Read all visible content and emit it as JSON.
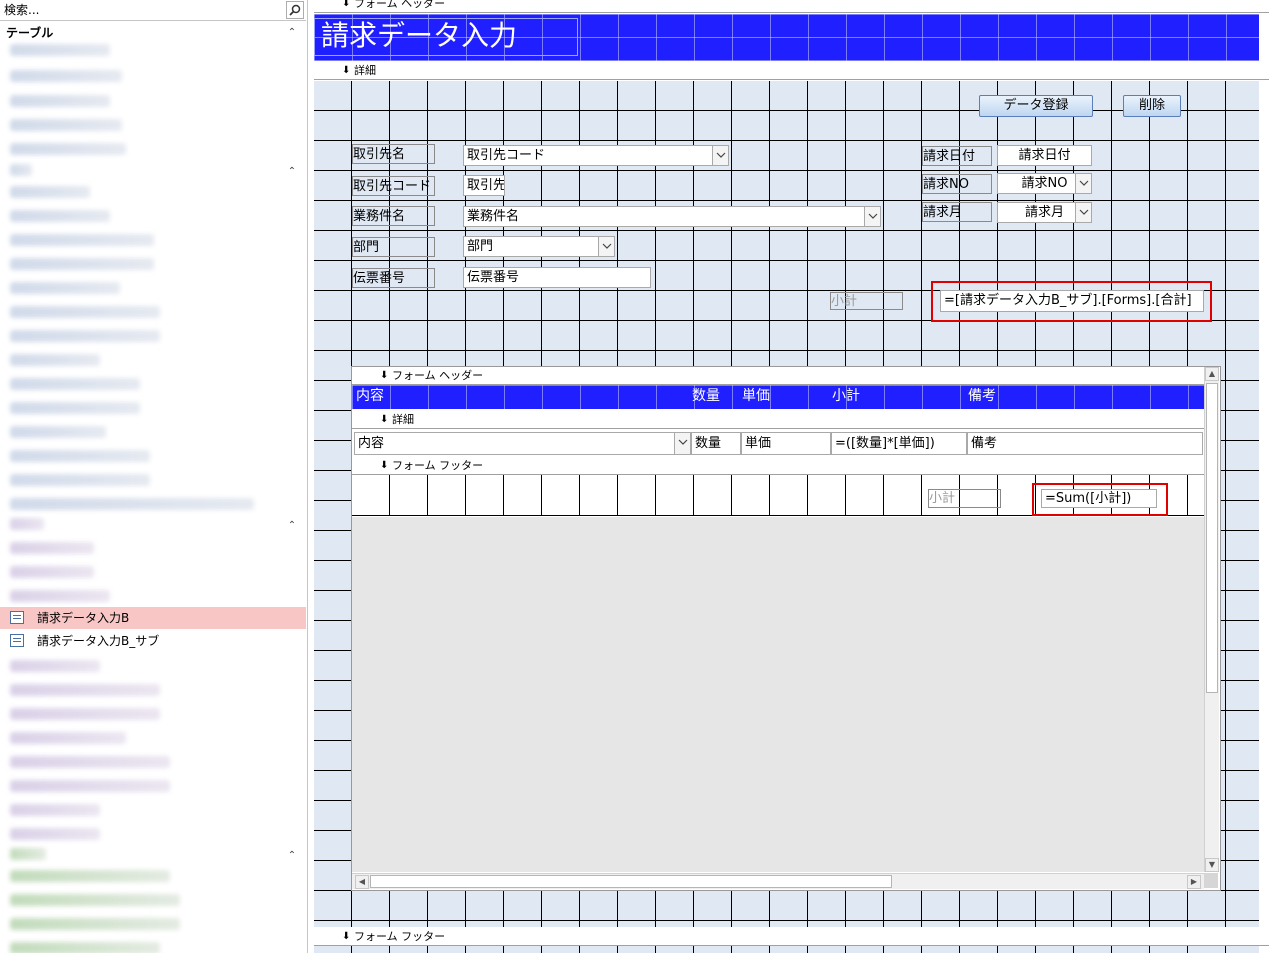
{
  "nav": {
    "search_placeholder": "検索...",
    "group_tables": "テーブル",
    "items": [
      {
        "label": "請求データ入力B",
        "selected": true
      },
      {
        "label": "請求データ入力B_サブ",
        "selected": false
      }
    ]
  },
  "main_form": {
    "sections": {
      "form_header": "フォーム ヘッダー",
      "detail": "詳細",
      "form_footer": "フォーム フッター"
    },
    "title": "請求データ入力",
    "buttons": {
      "register": "データ登録",
      "delete": "削除"
    },
    "labels": {
      "client_name": "取引先名",
      "client_code": "取引先コード",
      "project_name": "業務件名",
      "department": "部門",
      "slip_number": "伝票番号",
      "billing_date": "請求日付",
      "billing_no": "請求NO",
      "billing_month": "請求月",
      "subtotal": "小計"
    },
    "controls": {
      "client_name": "取引先コード",
      "client_code": "取引先",
      "project_name": "業務件名",
      "department": "部門",
      "slip_number": "伝票番号",
      "billing_date": "請求日付",
      "billing_no": "請求NO",
      "billing_month": "請求月",
      "total_expr": "=[請求データ入力B_サブ].[Forms].[合計]"
    }
  },
  "subform": {
    "sections": {
      "form_header": "フォーム ヘッダー",
      "detail": "詳細",
      "form_footer": "フォーム フッター"
    },
    "header_cells": {
      "content": "内容",
      "quantity": "数量",
      "unit_price": "単価",
      "subtotal": "小計",
      "remarks": "備考"
    },
    "detail_controls": {
      "content": "内容",
      "quantity": "数量",
      "unit_price": "単価",
      "subtotal_expr": "=([数量]*[単価])",
      "remarks": "備考"
    },
    "footer": {
      "subtotal_label": "小計",
      "sum_expr": "=Sum([小計])"
    }
  },
  "colors": {
    "header_band": "#1f1fff",
    "grid_bg": "#dfe8f3",
    "highlight": "#e00000",
    "selected_item": "#f9c6c6"
  }
}
